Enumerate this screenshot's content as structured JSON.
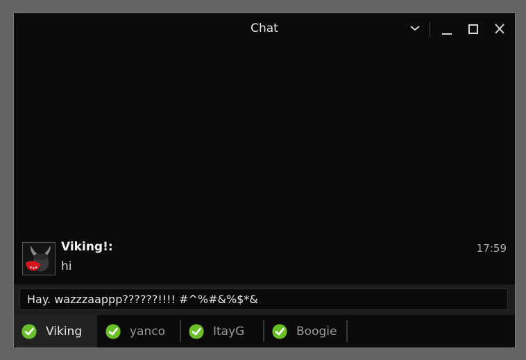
{
  "window": {
    "title": "Chat",
    "controls": [
      "chevron-down-icon",
      "minimize-icon",
      "maximize-icon",
      "close-icon"
    ]
  },
  "message": {
    "sender": "Viking!:",
    "text": "hi",
    "time": "17:59"
  },
  "composer": {
    "value": "Hay. wazzzaappp??????!!!! #^%#&%$*&"
  },
  "tabs": [
    {
      "label": "Viking",
      "active": true,
      "icon": "check-circle-icon"
    },
    {
      "label": "yanco",
      "active": false,
      "icon": "check-circle-icon"
    },
    {
      "label": "ItayG",
      "active": false,
      "icon": "check-circle-icon"
    },
    {
      "label": "Boogie",
      "active": false,
      "icon": "check-circle-icon"
    }
  ],
  "colors": {
    "background": "#0b0b0b",
    "frame": "#646464",
    "status_green": "#6bbf2a"
  }
}
